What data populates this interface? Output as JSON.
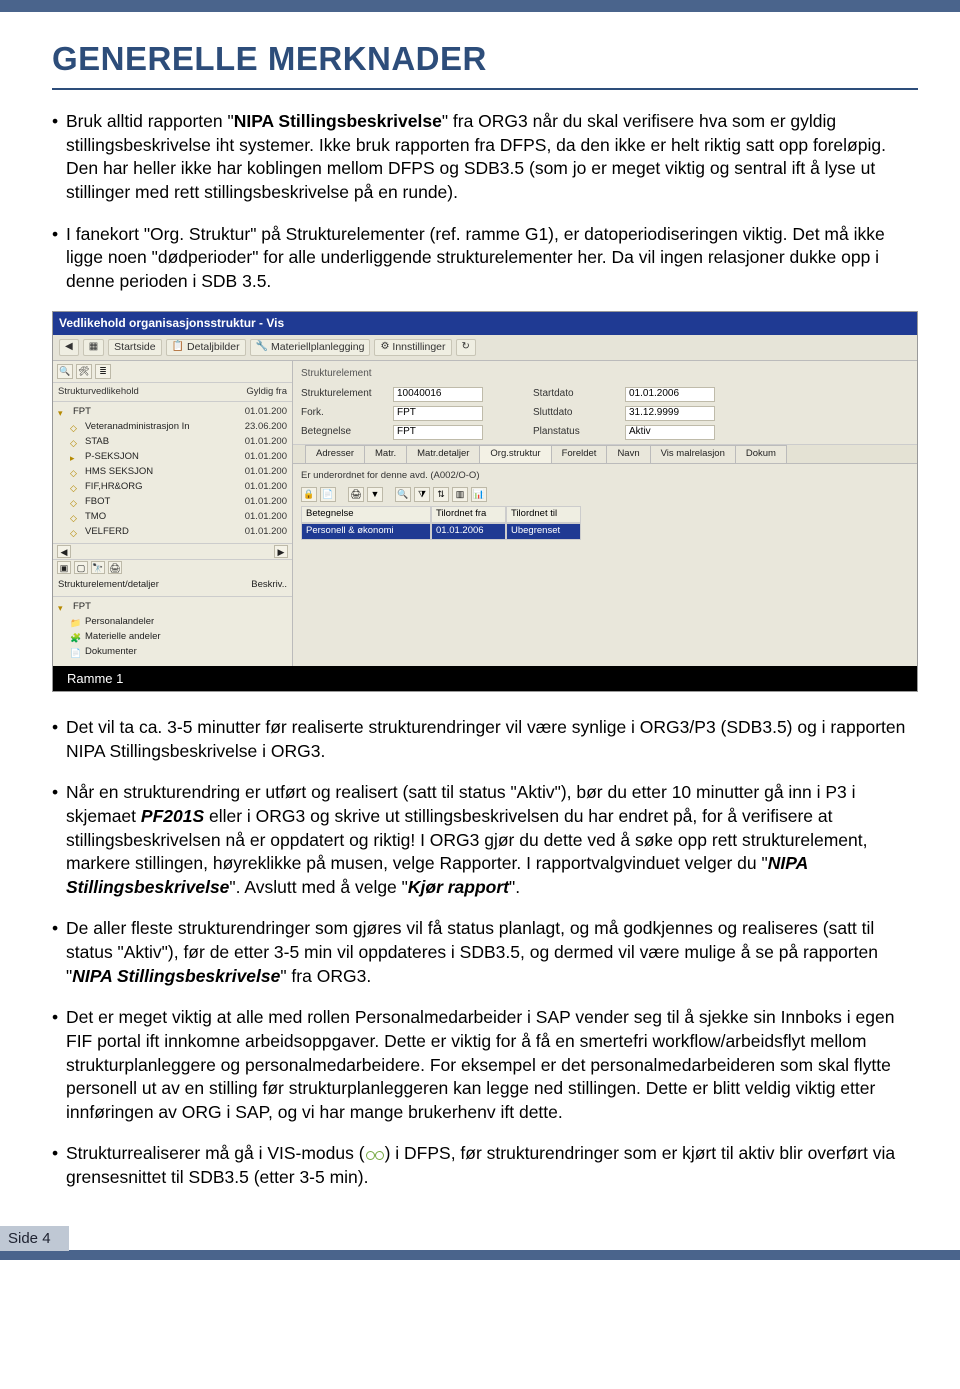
{
  "page": {
    "title": "GENERELLE MERKNADER",
    "side_label": "Side 4"
  },
  "bullets": {
    "b1_pre": "Bruk alltid rapporten \"",
    "b1_bold": "NIPA Stillingsbeskrivelse",
    "b1_post": "\" fra ORG3 når du skal verifisere hva som er gyldig stillingsbeskrivelse iht systemer. Ikke bruk rapporten fra DFPS, da den ikke er helt riktig satt opp foreløpig. Den har heller ikke har koblingen mellom DFPS og SDB3.5 (som jo er meget viktig og sentral ift å lyse ut stillinger med rett stillingsbeskrivelse på en runde).",
    "b2": "I fanekort \"Org. Struktur\" på Strukturelementer (ref. ramme G1), er datoperiodiseringen viktig. Det må ikke ligge noen \"dødperioder\" for alle underliggende strukturelementer her. Da vil ingen relasjoner dukke opp i denne perioden i SDB 3.5.",
    "b3": "Det vil ta ca. 3-5 minutter før realiserte strukturendringer vil være synlige i ORG3/P3 (SDB3.5) og i rapporten NIPA Stillingsbeskrivelse i ORG3.",
    "b4_a": "Når en strukturendring er utført og realisert (satt til status \"Aktiv\"), bør du etter 10 minutter gå inn i P3 i skjemaet ",
    "b4_bold1": "PF201S",
    "b4_b": " eller i ORG3 og skrive ut stillingsbeskrivelsen du har endret på, for å verifisere at stillingsbeskrivelsen nå er oppdatert og riktig! I ORG3 gjør du dette ved å søke opp rett strukturelement, markere stillingen, høyreklikke på musen, velge Rapporter. I rapportvalgvinduet velger du \"",
    "b4_bolditalic": "NIPA Stillingsbeskrivelse",
    "b4_c": "\". Avslutt med å velge \"",
    "b4_bolditalic2": "Kjør rapport",
    "b4_d": "\".",
    "b5_a": "De aller fleste strukturendringer som gjøres vil få status planlagt, og må godkjennes og realiseres (satt til status \"Aktiv\"), før de etter 3-5 min vil oppdateres i SDB3.5, og dermed vil være mulige å se på rapporten \"",
    "b5_bolditalic": "NIPA Stillingsbeskrivelse",
    "b5_b": "\" fra ORG3.",
    "b6": "Det er meget viktig at alle med rollen Personalmedarbeider i SAP vender seg til å sjekke sin Innboks i egen FIF portal ift innkomne arbeidsoppgaver. Dette er viktig for å få en smertefri workflow/arbeidsflyt mellom strukturplanleggere og personalmedarbeidere. For eksempel er det personalmedarbeideren som skal flytte personell ut av en stilling før strukturplanleggeren kan legge ned stillingen. Dette er blitt veldig viktig etter innføringen av ORG i SAP, og vi har mange brukerhenv ift dette.",
    "b7_a": "Strukturrealiserer må gå i VIS-modus (",
    "b7_b": ") i DFPS, før strukturendringer som er kjørt til aktiv blir overført via grensesnittet til SDB3.5 (etter 3-5 min)."
  },
  "shot": {
    "window_title": "Vedlikehold organisasjonsstruktur - Vis",
    "toolbar": {
      "startside": "Startside",
      "detaljbilder": "Detaljbilder",
      "materiell": "Materiellplanlegging",
      "innstillinger": "Innstillinger"
    },
    "left": {
      "col1": "Strukturvedlikehold",
      "col2": "Gyldig fra",
      "tree": [
        {
          "indent": 0,
          "icon": "▾",
          "label": "FPT",
          "date": "01.01.200"
        },
        {
          "indent": 1,
          "icon": "◇",
          "label": "Veteranadministrasjon In",
          "date": "23.06.200"
        },
        {
          "indent": 1,
          "icon": "◇",
          "label": "STAB",
          "date": "01.01.200"
        },
        {
          "indent": 1,
          "icon": "▸",
          "label": "P-SEKSJON",
          "date": "01.01.200"
        },
        {
          "indent": 1,
          "icon": "◇",
          "label": "HMS SEKSJON",
          "date": "01.01.200"
        },
        {
          "indent": 1,
          "icon": "◇",
          "label": "FIF,HR&ORG",
          "date": "01.01.200"
        },
        {
          "indent": 1,
          "icon": "◇",
          "label": "FBOT",
          "date": "01.01.200"
        },
        {
          "indent": 1,
          "icon": "◇",
          "label": "TMO",
          "date": "01.01.200"
        },
        {
          "indent": 1,
          "icon": "◇",
          "label": "VELFERD",
          "date": "01.01.200"
        }
      ],
      "detail_hdr1": "Strukturelement/detaljer",
      "detail_hdr2": "Beskriv..",
      "detail_tree": [
        {
          "indent": 0,
          "icon": "▾",
          "label": "FPT"
        },
        {
          "indent": 1,
          "icon": "📁",
          "label": "Personalandeler"
        },
        {
          "indent": 1,
          "icon": "🧩",
          "label": "Materielle andeler"
        },
        {
          "indent": 1,
          "icon": "📄",
          "label": "Dokumenter"
        }
      ]
    },
    "right": {
      "group_label": "Strukturelement",
      "fields_left": [
        {
          "label": "Strukturelement",
          "value": "10040016"
        },
        {
          "label": "Fork.",
          "value": "FPT"
        },
        {
          "label": "Betegnelse",
          "value": "FPT"
        }
      ],
      "fields_right": [
        {
          "label": "Startdato",
          "value": "01.01.2006"
        },
        {
          "label": "Sluttdato",
          "value": "31.12.9999"
        },
        {
          "label": "Planstatus",
          "value": "Aktiv"
        }
      ],
      "tabs": [
        "Adresser",
        "Matr.",
        "Matr.detaljer",
        "Org.struktur",
        "Foreldet",
        "Navn",
        "Vis malrelasjon",
        "Dokum"
      ],
      "active_tab_index": 3,
      "sub_label": "Er underordnet for denne avd. (A002/O-O)",
      "sub_headers": [
        "Betegnelse",
        "Tilordnet fra",
        "Tilordnet til"
      ],
      "sub_row": [
        "Personell & økonomi",
        "01.01.2006",
        "Ubegrenset"
      ]
    },
    "ramme": "Ramme 1"
  }
}
